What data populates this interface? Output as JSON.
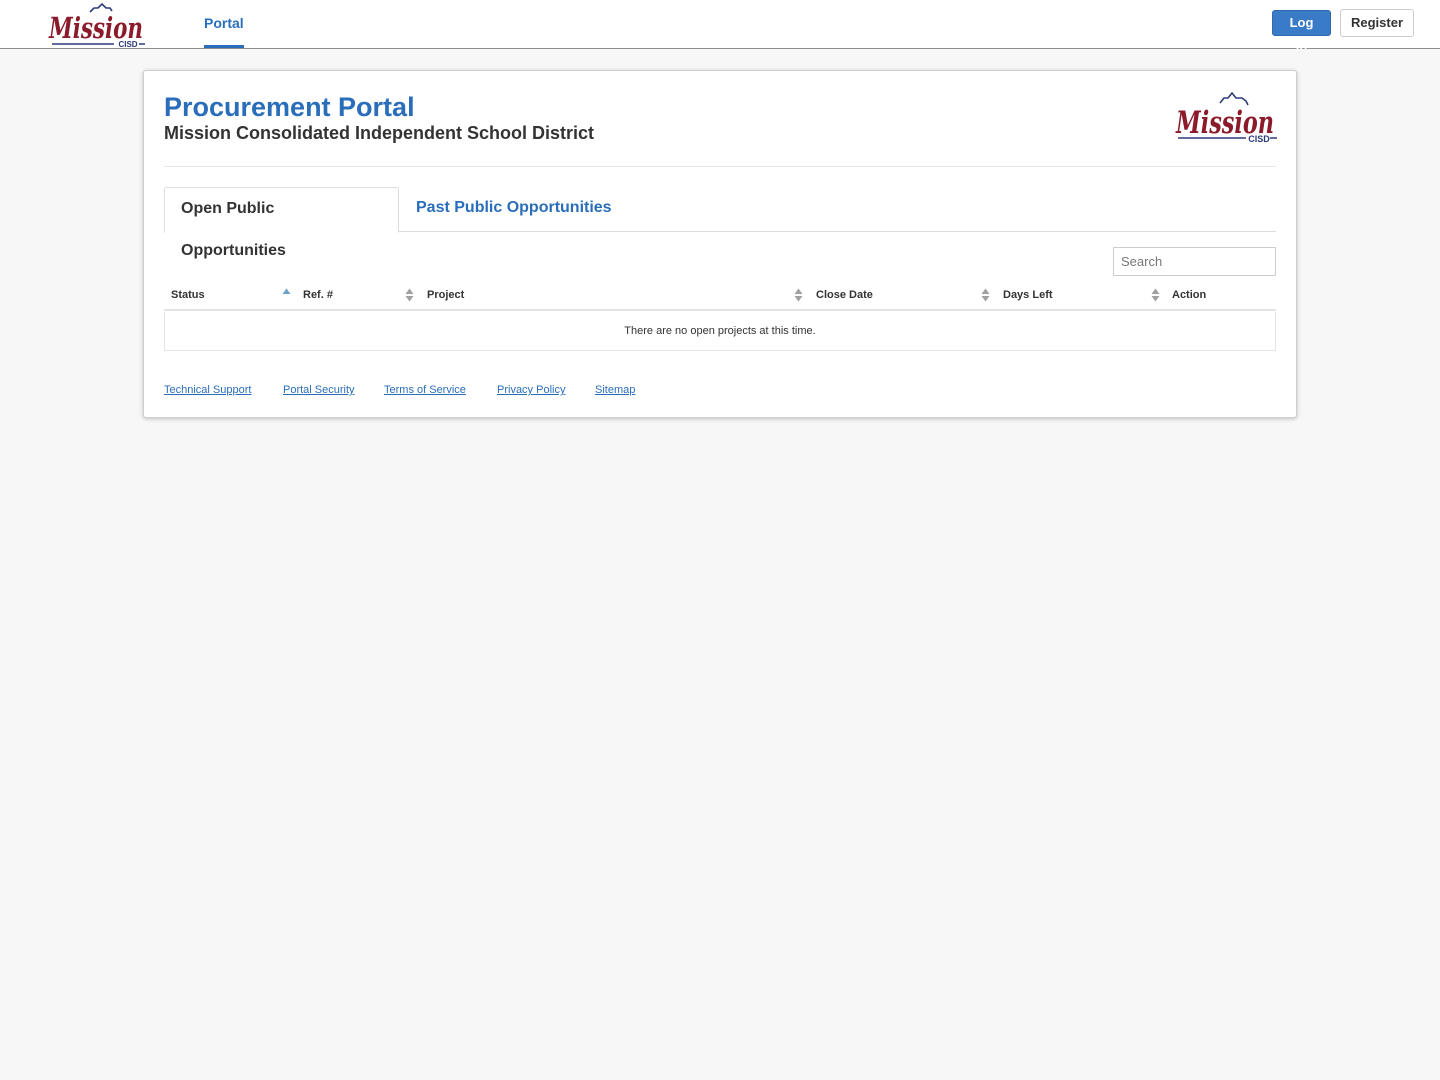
{
  "nav": {
    "logo_text": "Mission",
    "logo_sub": "CISD",
    "portal_label": "Portal",
    "login_label": "Log In",
    "register_label": "Register"
  },
  "header": {
    "title": "Procurement Portal",
    "subtitle": "Mission Consolidated Independent School District",
    "logo_text": "Mission",
    "logo_sub": "CISD"
  },
  "tabs": [
    {
      "label": "Open Public Opportunities",
      "active": true
    },
    {
      "label": "Past Public Opportunities",
      "active": false
    }
  ],
  "search": {
    "placeholder": "Search",
    "value": ""
  },
  "table": {
    "columns": [
      {
        "label": "Status",
        "sort": "ascending"
      },
      {
        "label": "Ref. #",
        "sort": "none"
      },
      {
        "label": "Project",
        "sort": "none"
      },
      {
        "label": "Close Date",
        "sort": "none"
      },
      {
        "label": "Days Left",
        "sort": "none"
      },
      {
        "label": "Action",
        "sort": "none"
      }
    ],
    "rows": [],
    "empty_message": "There are no open projects at this time."
  },
  "footer": {
    "links": [
      "Technical Support",
      "Portal Security",
      "Terms of Service",
      "Privacy Policy",
      "Sitemap"
    ]
  },
  "colors": {
    "brand_blue": "#2a6ebb",
    "logo_maroon": "#8b1a2b",
    "logo_navy": "#2b3a7a",
    "sort_active": "#6fa0c9",
    "sort_inactive": "#a0a0a0"
  },
  "icons": {
    "sort_ascending": "sort-ascending-icon",
    "sort_both": "sort-icon"
  }
}
